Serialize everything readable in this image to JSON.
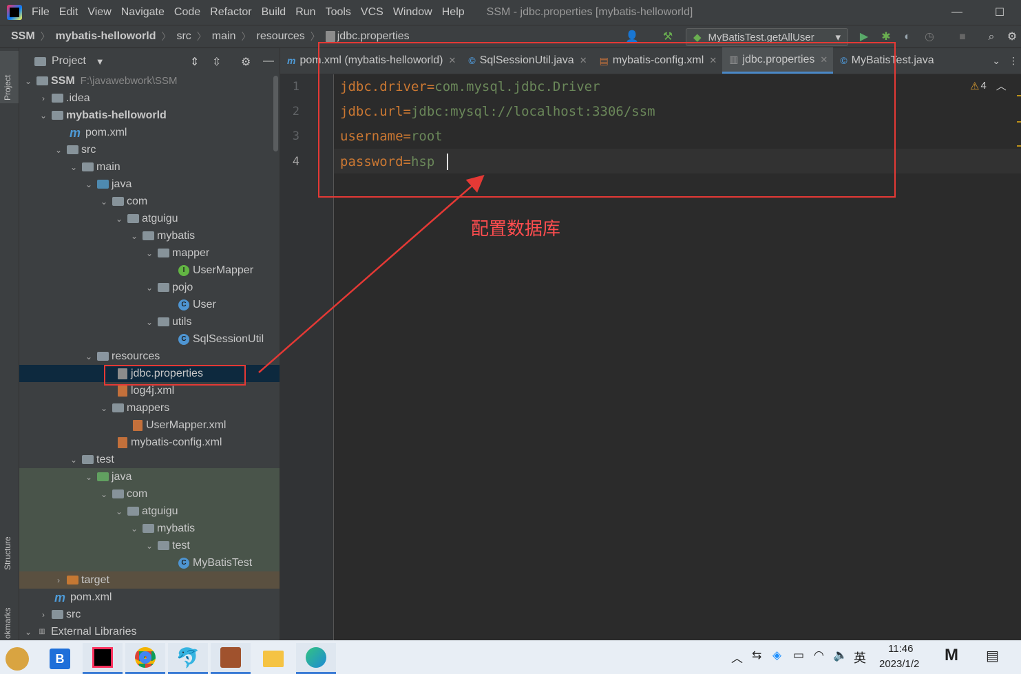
{
  "menu": [
    "File",
    "Edit",
    "View",
    "Navigate",
    "Code",
    "Refactor",
    "Build",
    "Run",
    "Tools",
    "VCS",
    "Window",
    "Help"
  ],
  "window_title": "SSM - jdbc.properties [mybatis-helloworld]",
  "breadcrumb": [
    "SSM",
    "mybatis-helloworld",
    "src",
    "main",
    "resources",
    "jdbc.properties"
  ],
  "run_config": "MyBatisTest.getAllUser",
  "stripe": {
    "project": "Project",
    "structure": "Structure",
    "bookmarks": "okmarks"
  },
  "project_panel": {
    "title": "Project"
  },
  "tree": [
    {
      "label": "SSM",
      "path": "F:\\javawebwork\\SSM",
      "bold": true
    },
    {
      "label": ".idea"
    },
    {
      "label": "mybatis-helloworld",
      "bold": true
    },
    {
      "label": "pom.xml"
    },
    {
      "label": "src"
    },
    {
      "label": "main"
    },
    {
      "label": "java"
    },
    {
      "label": "com"
    },
    {
      "label": "atguigu"
    },
    {
      "label": "mybatis"
    },
    {
      "label": "mapper"
    },
    {
      "label": "UserMapper"
    },
    {
      "label": "pojo"
    },
    {
      "label": "User"
    },
    {
      "label": "utils"
    },
    {
      "label": "SqlSessionUtil"
    },
    {
      "label": "resources"
    },
    {
      "label": "jdbc.properties"
    },
    {
      "label": "log4j.xml"
    },
    {
      "label": "mappers"
    },
    {
      "label": "UserMapper.xml"
    },
    {
      "label": "mybatis-config.xml"
    },
    {
      "label": "test"
    },
    {
      "label": "java"
    },
    {
      "label": "com"
    },
    {
      "label": "atguigu"
    },
    {
      "label": "mybatis"
    },
    {
      "label": "test"
    },
    {
      "label": "MyBatisTest"
    },
    {
      "label": "target"
    },
    {
      "label": "pom.xml"
    },
    {
      "label": "src"
    },
    {
      "label": "External Libraries"
    }
  ],
  "tabs": [
    {
      "label": "pom.xml (mybatis-helloworld)"
    },
    {
      "label": "SqlSessionUtil.java"
    },
    {
      "label": "mybatis-config.xml"
    },
    {
      "label": "jdbc.properties"
    },
    {
      "label": "MyBatisTest.java"
    }
  ],
  "code": [
    {
      "num": "1",
      "key": "jdbc.driver",
      "value": "com.mysql.jdbc.Driver"
    },
    {
      "num": "2",
      "key": "jdbc.url",
      "value": "jdbc:mysql://localhost:3306/ssm"
    },
    {
      "num": "3",
      "key": "username",
      "value": "root"
    },
    {
      "num": "4",
      "key": "password",
      "value": "hsp"
    }
  ],
  "warnings_count": "4",
  "annotation": "配置数据库",
  "taskbar": {
    "time": "11:46",
    "date": "2023/1/2",
    "ime": "英"
  },
  "colors": {
    "editor_bg": "#2b2b2b",
    "panel_bg": "#3c3f41",
    "annotation": "#e53935",
    "selection": "#0d293e"
  }
}
